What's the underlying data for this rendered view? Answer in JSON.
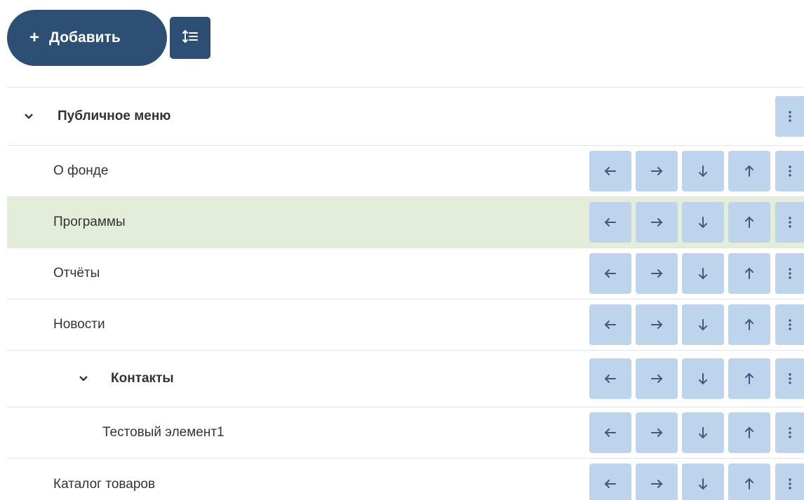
{
  "toolbar": {
    "add_label": "Добавить",
    "add_icon": "plus-icon",
    "sort_icon": "list-ordered-icon"
  },
  "tree": {
    "root": {
      "label": "Публичное меню",
      "expanded": true
    },
    "items": [
      {
        "label": "О фонде",
        "level": 1
      },
      {
        "label": "Программы",
        "level": 1,
        "highlighted": true
      },
      {
        "label": "Отчёты",
        "level": 1
      },
      {
        "label": "Новости",
        "level": 1
      },
      {
        "label": "Контакты",
        "level": 1,
        "expanded": true
      },
      {
        "label": "Тестовый элемент1",
        "level": 2
      },
      {
        "label": "Каталог товаров",
        "level": 1
      }
    ],
    "action_icons": [
      "arrow-left-icon",
      "arrow-right-icon",
      "arrow-down-icon",
      "arrow-up-icon",
      "more-vertical-icon"
    ]
  },
  "colors": {
    "primary": "#2d4f73",
    "action_bg": "#bed3ec",
    "action_icon": "#3a5b80",
    "highlight_row": "#e3edd9",
    "divider": "#e4e4e4"
  }
}
